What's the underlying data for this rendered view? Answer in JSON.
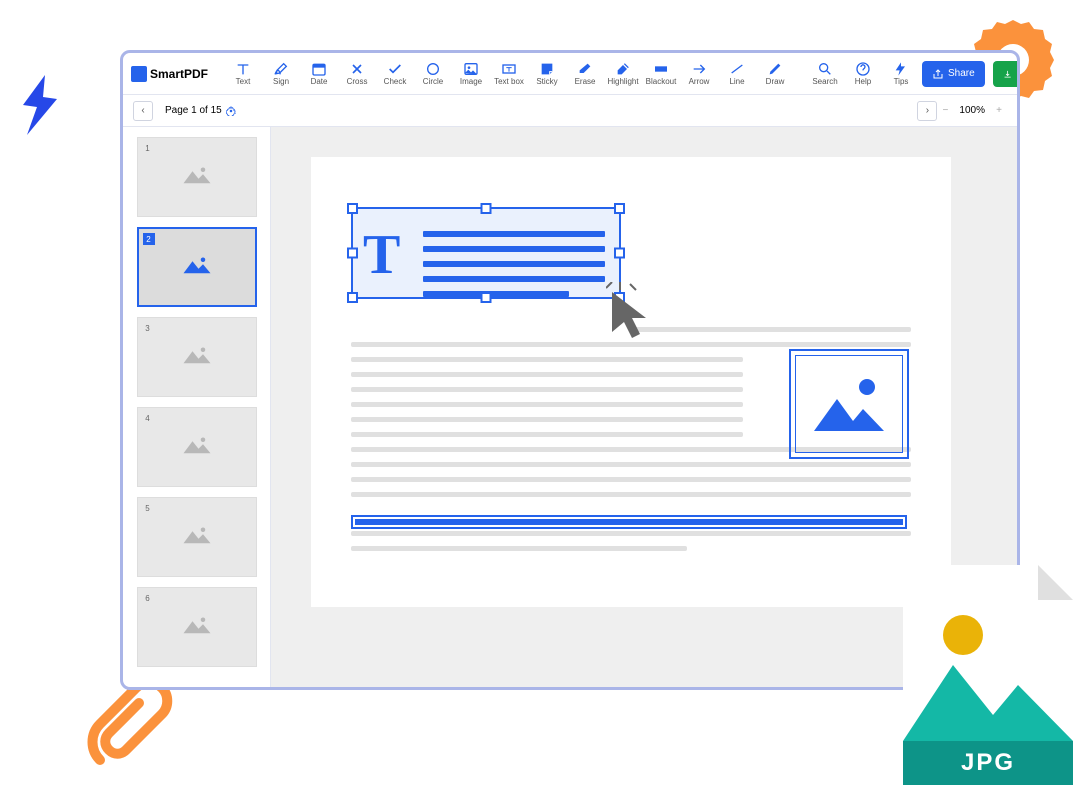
{
  "app": {
    "name": "SmartPDF"
  },
  "toolbar": {
    "tools": [
      {
        "id": "text",
        "label": "Text"
      },
      {
        "id": "sign",
        "label": "Sign"
      },
      {
        "id": "date",
        "label": "Date"
      },
      {
        "id": "cross",
        "label": "Cross"
      },
      {
        "id": "check",
        "label": "Check"
      },
      {
        "id": "circle",
        "label": "Circle"
      },
      {
        "id": "image",
        "label": "Image"
      },
      {
        "id": "textbox",
        "label": "Text box"
      },
      {
        "id": "sticky",
        "label": "Sticky"
      },
      {
        "id": "erase",
        "label": "Erase"
      },
      {
        "id": "highlight",
        "label": "Highlight"
      },
      {
        "id": "blackout",
        "label": "Blackout"
      },
      {
        "id": "arrow",
        "label": "Arrow"
      },
      {
        "id": "line",
        "label": "Line"
      },
      {
        "id": "draw",
        "label": "Draw"
      }
    ],
    "right_tools": [
      {
        "id": "search",
        "label": "Search"
      },
      {
        "id": "help",
        "label": "Help"
      },
      {
        "id": "tips",
        "label": "Tips"
      }
    ],
    "share_label": "Share",
    "download_label": "Download pdf"
  },
  "pager": {
    "label": "Page 1 of 15"
  },
  "zoom": {
    "value": "100%"
  },
  "thumbnails": {
    "count": 6,
    "selected": 2,
    "items": [
      {
        "num": "1"
      },
      {
        "num": "2"
      },
      {
        "num": "3"
      },
      {
        "num": "4"
      },
      {
        "num": "5"
      },
      {
        "num": "6"
      }
    ]
  },
  "file_badge": {
    "label": "JPG"
  },
  "editor": {
    "text_selection": {
      "letter": "T"
    }
  }
}
